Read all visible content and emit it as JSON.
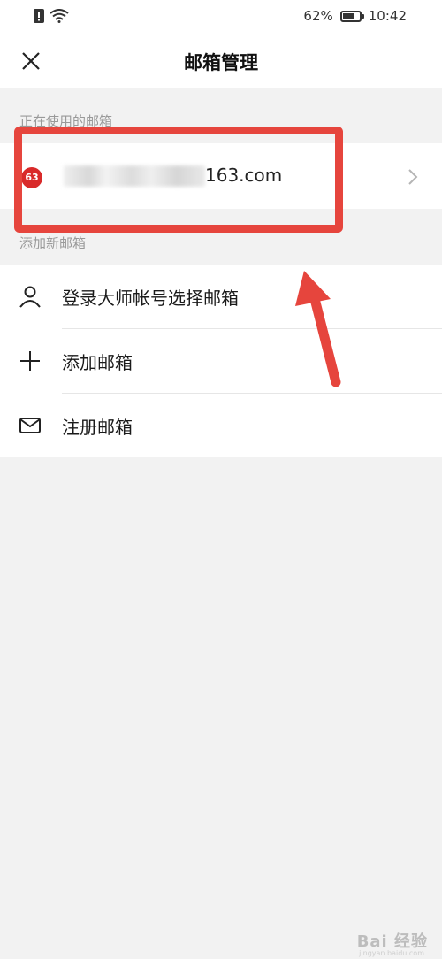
{
  "status_bar": {
    "battery_percent": "62%",
    "time": "10:42",
    "icons": [
      "notification-icon",
      "wifi-icon",
      "battery-icon"
    ]
  },
  "header": {
    "title": "邮箱管理",
    "close_icon": "close-icon"
  },
  "current_section": {
    "label": "正在使用的邮箱",
    "account": {
      "badge": "63",
      "email_visible_suffix": "163.com"
    }
  },
  "add_section": {
    "label": "添加新邮箱",
    "options": [
      {
        "label": "登录大师帐号选择邮箱",
        "icon": "person-icon"
      },
      {
        "label": "添加邮箱",
        "icon": "plus-icon"
      },
      {
        "label": "注册邮箱",
        "icon": "mail-icon"
      }
    ]
  },
  "colors": {
    "annotation_red": "#e6453d",
    "badge_red": "#d92a2a",
    "background": "#f2f2f2"
  },
  "watermark": {
    "text": "Bai 经验",
    "sub": "jingyan.baidu.com"
  }
}
